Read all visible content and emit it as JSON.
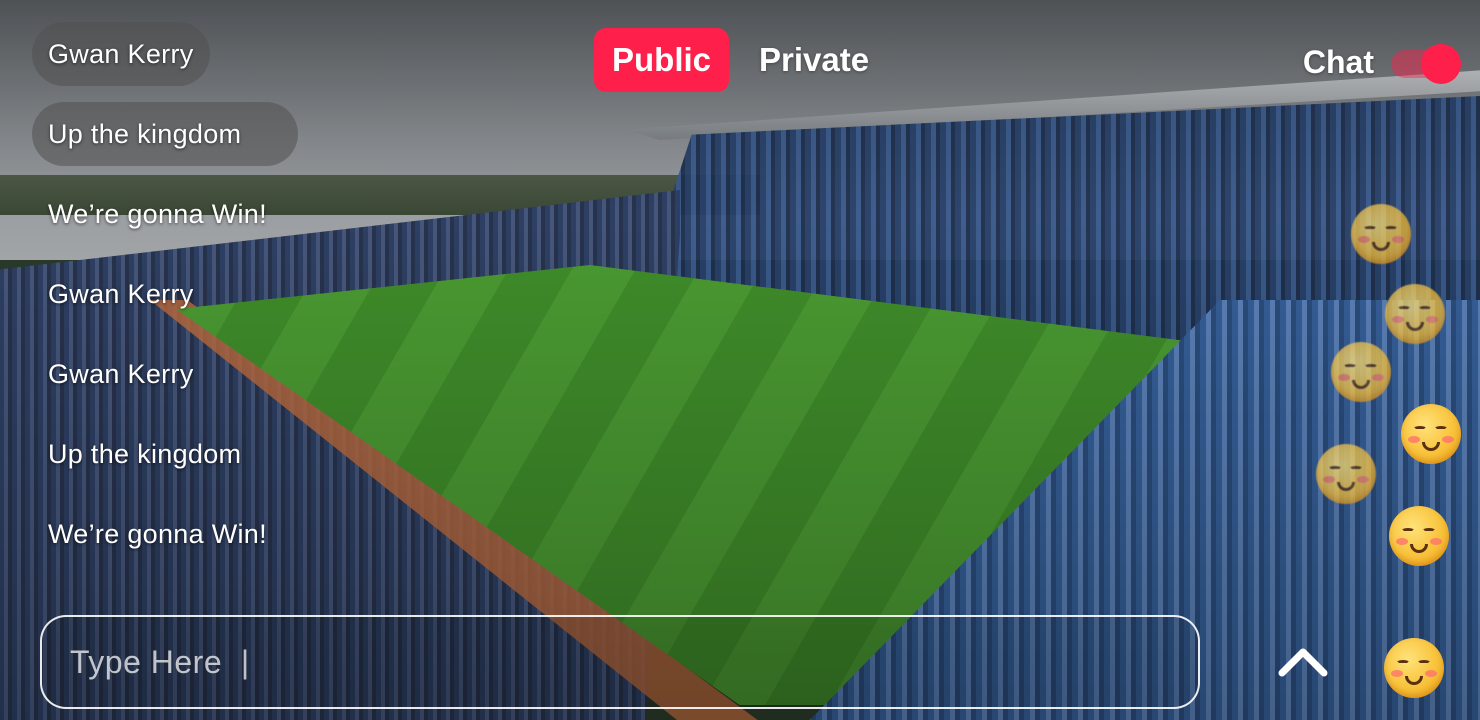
{
  "messages": [
    {
      "text": "Gwan Kerry",
      "bubble": true
    },
    {
      "text": "Up the kingdom",
      "bubble": true
    },
    {
      "text": "We’re gonna Win!",
      "bubble": false
    },
    {
      "text": "Gwan Kerry",
      "bubble": false
    },
    {
      "text": "Gwan Kerry",
      "bubble": false
    },
    {
      "text": "Up the kingdom",
      "bubble": false
    },
    {
      "text": "We’re gonna Win!",
      "bubble": false
    }
  ],
  "tabs": [
    {
      "label": "Public",
      "active": true
    },
    {
      "label": "Private",
      "active": false
    }
  ],
  "chat_toggle": {
    "label": "Chat",
    "on": true
  },
  "composer": {
    "placeholder": "Type Here  |"
  },
  "reactions": {
    "icon": "smiling-face-emoji-icon",
    "count": 7
  },
  "colors": {
    "accent": "#ff1f4b",
    "text": "#ffffff"
  }
}
